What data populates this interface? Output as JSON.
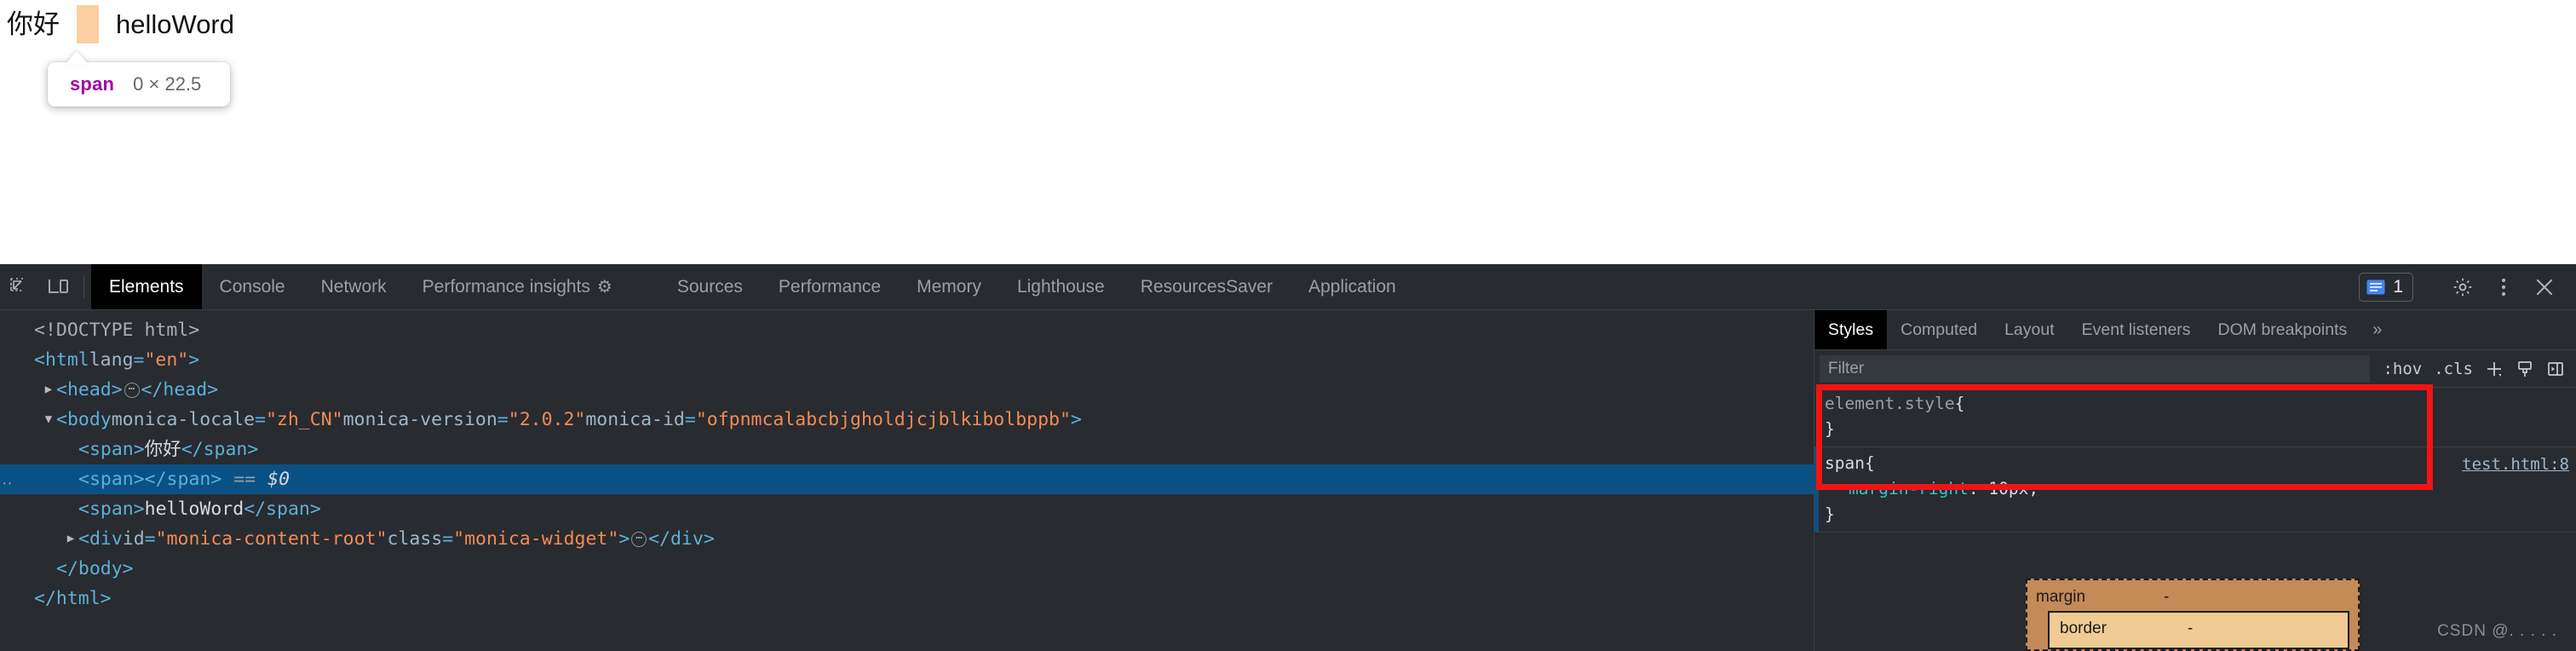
{
  "page": {
    "text_first": "你好",
    "empty_span_placeholder": "",
    "text_second": "helloWord"
  },
  "inspect_tooltip": {
    "tag": "span",
    "dimensions": "0 × 22.5"
  },
  "devtools": {
    "toolbar": {
      "inspect_icon": "inspect-cursor-icon",
      "device_icon": "device-toolbar-icon",
      "tabs": [
        {
          "label": "Elements",
          "active": true,
          "icon": ""
        },
        {
          "label": "Console",
          "active": false,
          "icon": ""
        },
        {
          "label": "Network",
          "active": false,
          "icon": ""
        },
        {
          "label": "Performance insights",
          "active": false,
          "icon": "flask-icon"
        },
        {
          "label": "Sources",
          "active": false,
          "icon": ""
        },
        {
          "label": "Performance",
          "active": false,
          "icon": ""
        },
        {
          "label": "Memory",
          "active": false,
          "icon": ""
        },
        {
          "label": "Lighthouse",
          "active": false,
          "icon": ""
        },
        {
          "label": "ResourcesSaver",
          "active": false,
          "icon": ""
        },
        {
          "label": "Application",
          "active": false,
          "icon": ""
        }
      ],
      "message_count": "1",
      "settings_icon": "gear-icon",
      "more_icon": "kebab-menu-icon",
      "close_icon": "close-icon"
    },
    "dom_tree": {
      "rows": [
        {
          "indent": 0,
          "twisty": "",
          "selected": false,
          "parts": [
            {
              "t": "doctype",
              "v": "<!DOCTYPE html>"
            }
          ]
        },
        {
          "indent": 0,
          "twisty": "",
          "selected": false,
          "parts": [
            {
              "t": "tag",
              "v": "<html "
            },
            {
              "t": "attr",
              "v": "lang"
            },
            {
              "t": "tag",
              "v": "="
            },
            {
              "t": "val",
              "v": "\"en\""
            },
            {
              "t": "tag",
              "v": ">"
            }
          ]
        },
        {
          "indent": 1,
          "twisty": "closed",
          "selected": false,
          "parts": [
            {
              "t": "tag",
              "v": "<head>"
            },
            {
              "t": "pill",
              "v": "…"
            },
            {
              "t": "tag",
              "v": "</head>"
            }
          ]
        },
        {
          "indent": 1,
          "twisty": "open",
          "selected": false,
          "parts": [
            {
              "t": "tag",
              "v": "<body "
            },
            {
              "t": "attr",
              "v": "monica-locale"
            },
            {
              "t": "tag",
              "v": "="
            },
            {
              "t": "val",
              "v": "\"zh_CN\""
            },
            {
              "t": "attr",
              "v": " monica-version"
            },
            {
              "t": "tag",
              "v": "="
            },
            {
              "t": "val",
              "v": "\"2.0.2\""
            },
            {
              "t": "attr",
              "v": " monica-id"
            },
            {
              "t": "tag",
              "v": "="
            },
            {
              "t": "val",
              "v": "\"ofpnmcalabcbjgholdjcjblkibolbppb\""
            },
            {
              "t": "tag",
              "v": ">"
            }
          ]
        },
        {
          "indent": 2,
          "twisty": "",
          "selected": false,
          "parts": [
            {
              "t": "tag",
              "v": "<span>"
            },
            {
              "t": "text",
              "v": "你好"
            },
            {
              "t": "tag",
              "v": "</span>"
            }
          ]
        },
        {
          "indent": 2,
          "twisty": "",
          "selected": true,
          "parts": [
            {
              "t": "tag",
              "v": "<span></span>"
            },
            {
              "t": "eq",
              "v": "=="
            },
            {
              "t": "selmark",
              "v": "$0"
            }
          ]
        },
        {
          "indent": 2,
          "twisty": "",
          "selected": false,
          "parts": [
            {
              "t": "tag",
              "v": "<span>"
            },
            {
              "t": "text",
              "v": "helloWord"
            },
            {
              "t": "tag",
              "v": "</span>"
            }
          ]
        },
        {
          "indent": 2,
          "twisty": "closed",
          "selected": false,
          "parts": [
            {
              "t": "tag",
              "v": "<div "
            },
            {
              "t": "attr",
              "v": "id"
            },
            {
              "t": "tag",
              "v": "="
            },
            {
              "t": "val",
              "v": "\"monica-content-root\""
            },
            {
              "t": "attr",
              "v": " class"
            },
            {
              "t": "tag",
              "v": "="
            },
            {
              "t": "val",
              "v": "\"monica-widget\""
            },
            {
              "t": "tag",
              "v": ">"
            },
            {
              "t": "pill",
              "v": "…"
            },
            {
              "t": "tag",
              "v": "</div>"
            }
          ]
        },
        {
          "indent": 1,
          "twisty": "",
          "selected": false,
          "parts": [
            {
              "t": "tag",
              "v": "</body>"
            }
          ]
        },
        {
          "indent": 0,
          "twisty": "",
          "selected": false,
          "parts": [
            {
              "t": "tag",
              "v": "</html>"
            }
          ]
        }
      ]
    },
    "styles": {
      "tabs": [
        {
          "label": "Styles",
          "active": true
        },
        {
          "label": "Computed",
          "active": false
        },
        {
          "label": "Layout",
          "active": false
        },
        {
          "label": "Event listeners",
          "active": false
        },
        {
          "label": "DOM breakpoints",
          "active": false
        }
      ],
      "more_tabs_icon": "chevron-double-right-icon",
      "filter_placeholder": "Filter",
      "actions": [
        {
          "label": ":hov",
          "name": "hover-states-button"
        },
        {
          "label": ".cls",
          "name": "element-classes-button"
        }
      ],
      "new_rule_icon": "plus-icon",
      "color_picker_icon": "paint-brush-icon",
      "sidebar_toggle_icon": "panel-toggle-icon",
      "rules": [
        {
          "selector": "element.style",
          "origin": "",
          "declarations": [],
          "active": false,
          "highlighted": false
        },
        {
          "selector": "span",
          "origin": "test.html:8",
          "declarations": [
            {
              "property": "margin-right",
              "value": "10px"
            }
          ],
          "active": true,
          "highlighted": true
        }
      ],
      "box_model": {
        "margin_label": "margin",
        "margin_value": "-",
        "border_label": "border",
        "border_value": "-",
        "margin_color": "#c48a58",
        "border_color": "#f0cb93"
      }
    },
    "watermark": "CSDN @.  . . . ."
  }
}
